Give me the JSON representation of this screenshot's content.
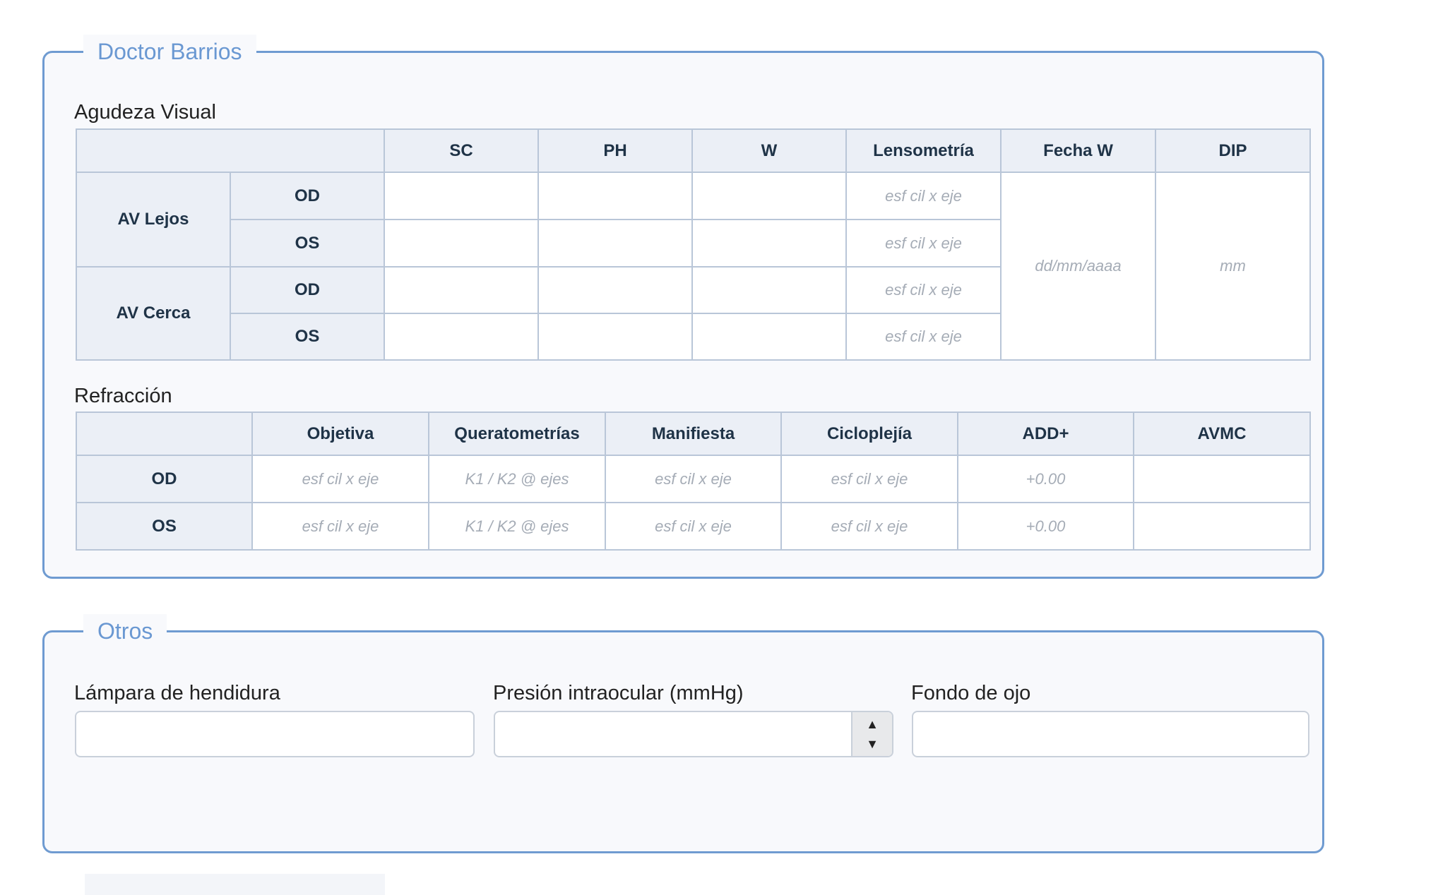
{
  "panel1": {
    "legend": "Doctor Barrios",
    "av": {
      "title": "Agudeza Visual",
      "headers": [
        "SC",
        "PH",
        "W",
        "Lensometría",
        "Fecha W",
        "DIP"
      ],
      "groups": [
        "AV Lejos",
        "AV Cerca"
      ],
      "eyes": [
        "OD",
        "OS"
      ],
      "lens_placeholder": "esf cil x eje",
      "fecha_placeholder": "dd/mm/aaaa",
      "dip_placeholder": "mm"
    },
    "ref": {
      "title": "Refracción",
      "headers": [
        "Objetiva",
        "Queratometrías",
        "Manifiesta",
        "Cicloplejía",
        "ADD+",
        "AVMC"
      ],
      "rows": [
        {
          "eye": "OD",
          "objetiva": "esf cil x eje",
          "querato": "K1 / K2 @ ejes",
          "manifiesta": "esf cil x eje",
          "ciclo": "esf cil x eje",
          "add": "+0.00"
        },
        {
          "eye": "OS",
          "objetiva": "esf cil x eje",
          "querato": "K1 / K2 @ ejes",
          "manifiesta": "esf cil x eje",
          "ciclo": "esf cil x eje",
          "add": "+0.00"
        }
      ]
    }
  },
  "panel2": {
    "legend": "Otros",
    "fields": {
      "lampara": "Lámpara de hendidura",
      "presion": "Presión intraocular (mmHg)",
      "fondo": "Fondo de ojo"
    },
    "spinner": {
      "up": "▲",
      "down": "▼"
    }
  },
  "colors": {
    "accent": "#6f9bd1",
    "legend_text": "#6a98d2",
    "header_bg": "#ebeff6",
    "border": "#b9c6d8"
  }
}
